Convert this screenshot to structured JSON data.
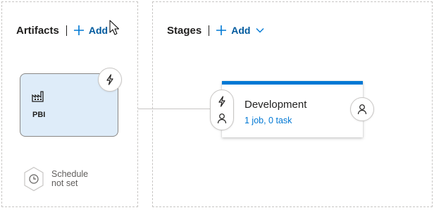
{
  "artifacts": {
    "title": "Artifacts",
    "add_label": "Add",
    "items": [
      {
        "name": "PBI",
        "icon": "build-pipeline-icon"
      }
    ],
    "schedule": {
      "text_line1": "Schedule",
      "text_line2": "not set",
      "icon": "clock-icon"
    }
  },
  "stages": {
    "title": "Stages",
    "add_label": "Add",
    "items": [
      {
        "name": "Development",
        "tasks": "1 job, 0 task"
      }
    ]
  },
  "colors": {
    "accent": "#0078d4",
    "link": "#005a9e",
    "artifact_bg": "#deecf9",
    "border": "#c8c6c4"
  }
}
